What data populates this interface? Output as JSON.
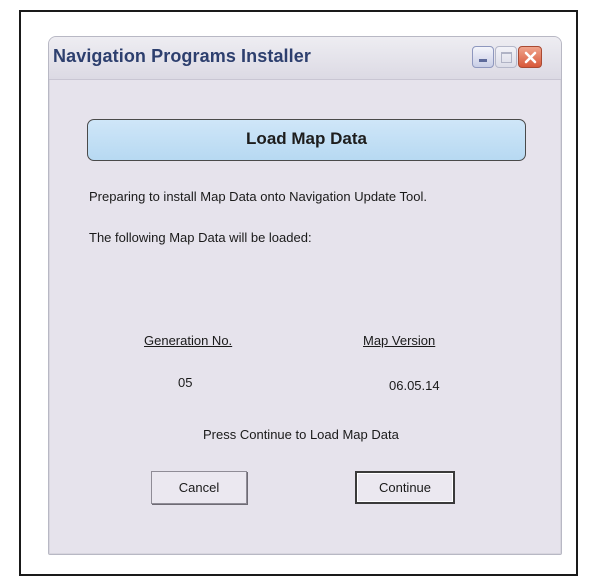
{
  "window": {
    "title": "Navigation Programs Installer",
    "controls": [
      "minimize-icon",
      "maximize-icon",
      "close-icon"
    ]
  },
  "dialog": {
    "heading": "Load Map Data",
    "intro_line_1": "Preparing to install Map Data onto Navigation Update Tool.",
    "intro_line_2": "The following Map Data will be loaded:",
    "generation_header": "Generation No.",
    "generation_value": "05",
    "map_version_header": "Map Version",
    "map_version_value": "06.05.14",
    "instruction": "Press Continue to Load Map Data",
    "cancel_label": "Cancel",
    "continue_label": "Continue"
  },
  "colors": {
    "title_text": "#2d3f6e",
    "header_fill": "#c4dff5",
    "window_bg": "#e6e3ec",
    "close_button": "#d8583a"
  }
}
